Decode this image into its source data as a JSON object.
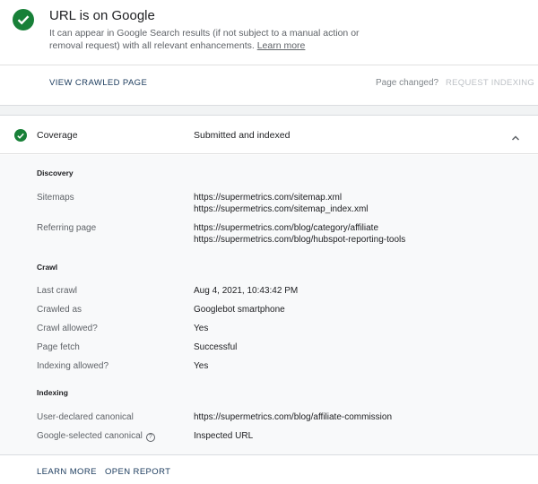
{
  "header": {
    "title": "URL is on Google",
    "description": "It can appear in Google Search results (if not subject to a manual action or removal request) with all relevant enhancements.",
    "learn_more": "Learn more"
  },
  "actions": {
    "view_crawled_page": "VIEW CRAWLED PAGE",
    "page_changed": "Page changed?",
    "request_indexing": "REQUEST INDEXING"
  },
  "coverage": {
    "label": "Coverage",
    "value": "Submitted and indexed"
  },
  "discovery": {
    "title": "Discovery",
    "sitemaps_label": "Sitemaps",
    "sitemaps": [
      "https://supermetrics.com/sitemap.xml",
      "https://supermetrics.com/sitemap_index.xml"
    ],
    "referring_label": "Referring page",
    "referring": [
      "https://supermetrics.com/blog/category/affiliate",
      "https://supermetrics.com/blog/hubspot-reporting-tools"
    ]
  },
  "crawl": {
    "title": "Crawl",
    "rows": [
      {
        "label": "Last crawl",
        "value": "Aug 4, 2021, 10:43:42 PM"
      },
      {
        "label": "Crawled as",
        "value": "Googlebot smartphone"
      },
      {
        "label": "Crawl allowed?",
        "value": "Yes"
      },
      {
        "label": "Page fetch",
        "value": "Successful"
      },
      {
        "label": "Indexing allowed?",
        "value": "Yes"
      }
    ]
  },
  "indexing": {
    "title": "Indexing",
    "rows": [
      {
        "label": "User-declared canonical",
        "value": "https://supermetrics.com/blog/affiliate-commission"
      },
      {
        "label": "Google-selected canonical",
        "value": "Inspected URL"
      }
    ],
    "help_glyph": "?"
  },
  "footer": {
    "learn_more": "LEARN MORE",
    "open_report": "OPEN REPORT"
  },
  "colors": {
    "success_green": "#188038",
    "link_navy": "#1a3a5c",
    "muted_text": "#5f6368",
    "disabled_text": "#bdc1c6"
  }
}
